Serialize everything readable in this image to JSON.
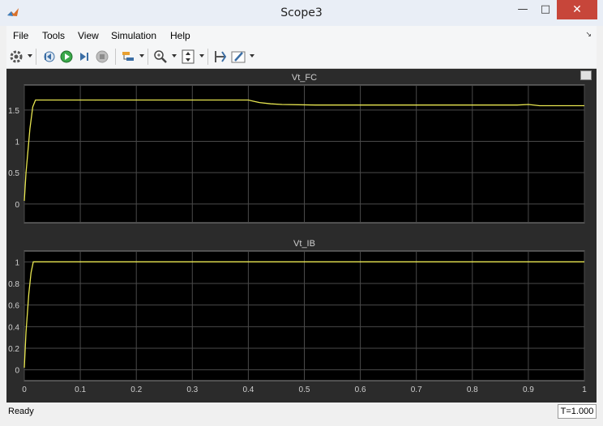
{
  "window": {
    "title": "Scope3"
  },
  "menu": {
    "items": [
      "File",
      "Tools",
      "View",
      "Simulation",
      "Help"
    ]
  },
  "toolbar": {
    "icons": [
      "gear-icon",
      "step-back-icon",
      "run-icon",
      "step-forward-icon",
      "stop-icon",
      "signal-selector-icon",
      "zoom-icon",
      "scale-axes-icon",
      "cursor-measure-icon",
      "style-icon"
    ]
  },
  "colors": {
    "plot_bg": "#000000",
    "frame_bg": "#2b2b2b",
    "grid": "#4a4a4a",
    "trace": "#e8e650",
    "text": "#cfcfcf"
  },
  "chart_data": [
    {
      "type": "line",
      "title": "Vt_FC",
      "xlim": [
        0,
        1
      ],
      "ylim": [
        -0.3,
        1.9
      ],
      "yticks": [
        0,
        0.5,
        1,
        1.5
      ],
      "ytick_labels": [
        "0",
        "0.5",
        "1",
        "1.5"
      ],
      "xticks": [
        0,
        0.1,
        0.2,
        0.3,
        0.4,
        0.5,
        0.6,
        0.7,
        0.8,
        0.9,
        1
      ],
      "xtick_labels": [],
      "series": [
        {
          "x": [
            0,
            0.003,
            0.01,
            0.015,
            0.02,
            0.4,
            0.41,
            0.42,
            0.44,
            0.46,
            0.52,
            0.88,
            0.9,
            0.92,
            1
          ],
          "y": [
            0.05,
            0.5,
            1.2,
            1.55,
            1.66,
            1.66,
            1.64,
            1.62,
            1.6,
            1.59,
            1.58,
            1.58,
            1.59,
            1.57,
            1.57
          ]
        }
      ]
    },
    {
      "type": "line",
      "title": "Vt_IB",
      "xlim": [
        0,
        1
      ],
      "ylim": [
        -0.1,
        1.1
      ],
      "yticks": [
        0,
        0.2,
        0.4,
        0.6,
        0.8,
        1
      ],
      "ytick_labels": [
        "0",
        "0.2",
        "0.4",
        "0.6",
        "0.8",
        "1"
      ],
      "xticks": [
        0,
        0.1,
        0.2,
        0.3,
        0.4,
        0.5,
        0.6,
        0.7,
        0.8,
        0.9,
        1
      ],
      "xtick_labels": [
        "0",
        "0.1",
        "0.2",
        "0.3",
        "0.4",
        "0.5",
        "0.6",
        "0.7",
        "0.8",
        "0.9",
        "1"
      ],
      "series": [
        {
          "x": [
            0,
            0.003,
            0.008,
            0.012,
            0.016,
            1
          ],
          "y": [
            0.02,
            0.35,
            0.7,
            0.9,
            1.0,
            1.0
          ]
        }
      ]
    }
  ],
  "status": {
    "text": "Ready",
    "time": "T=1.000"
  }
}
